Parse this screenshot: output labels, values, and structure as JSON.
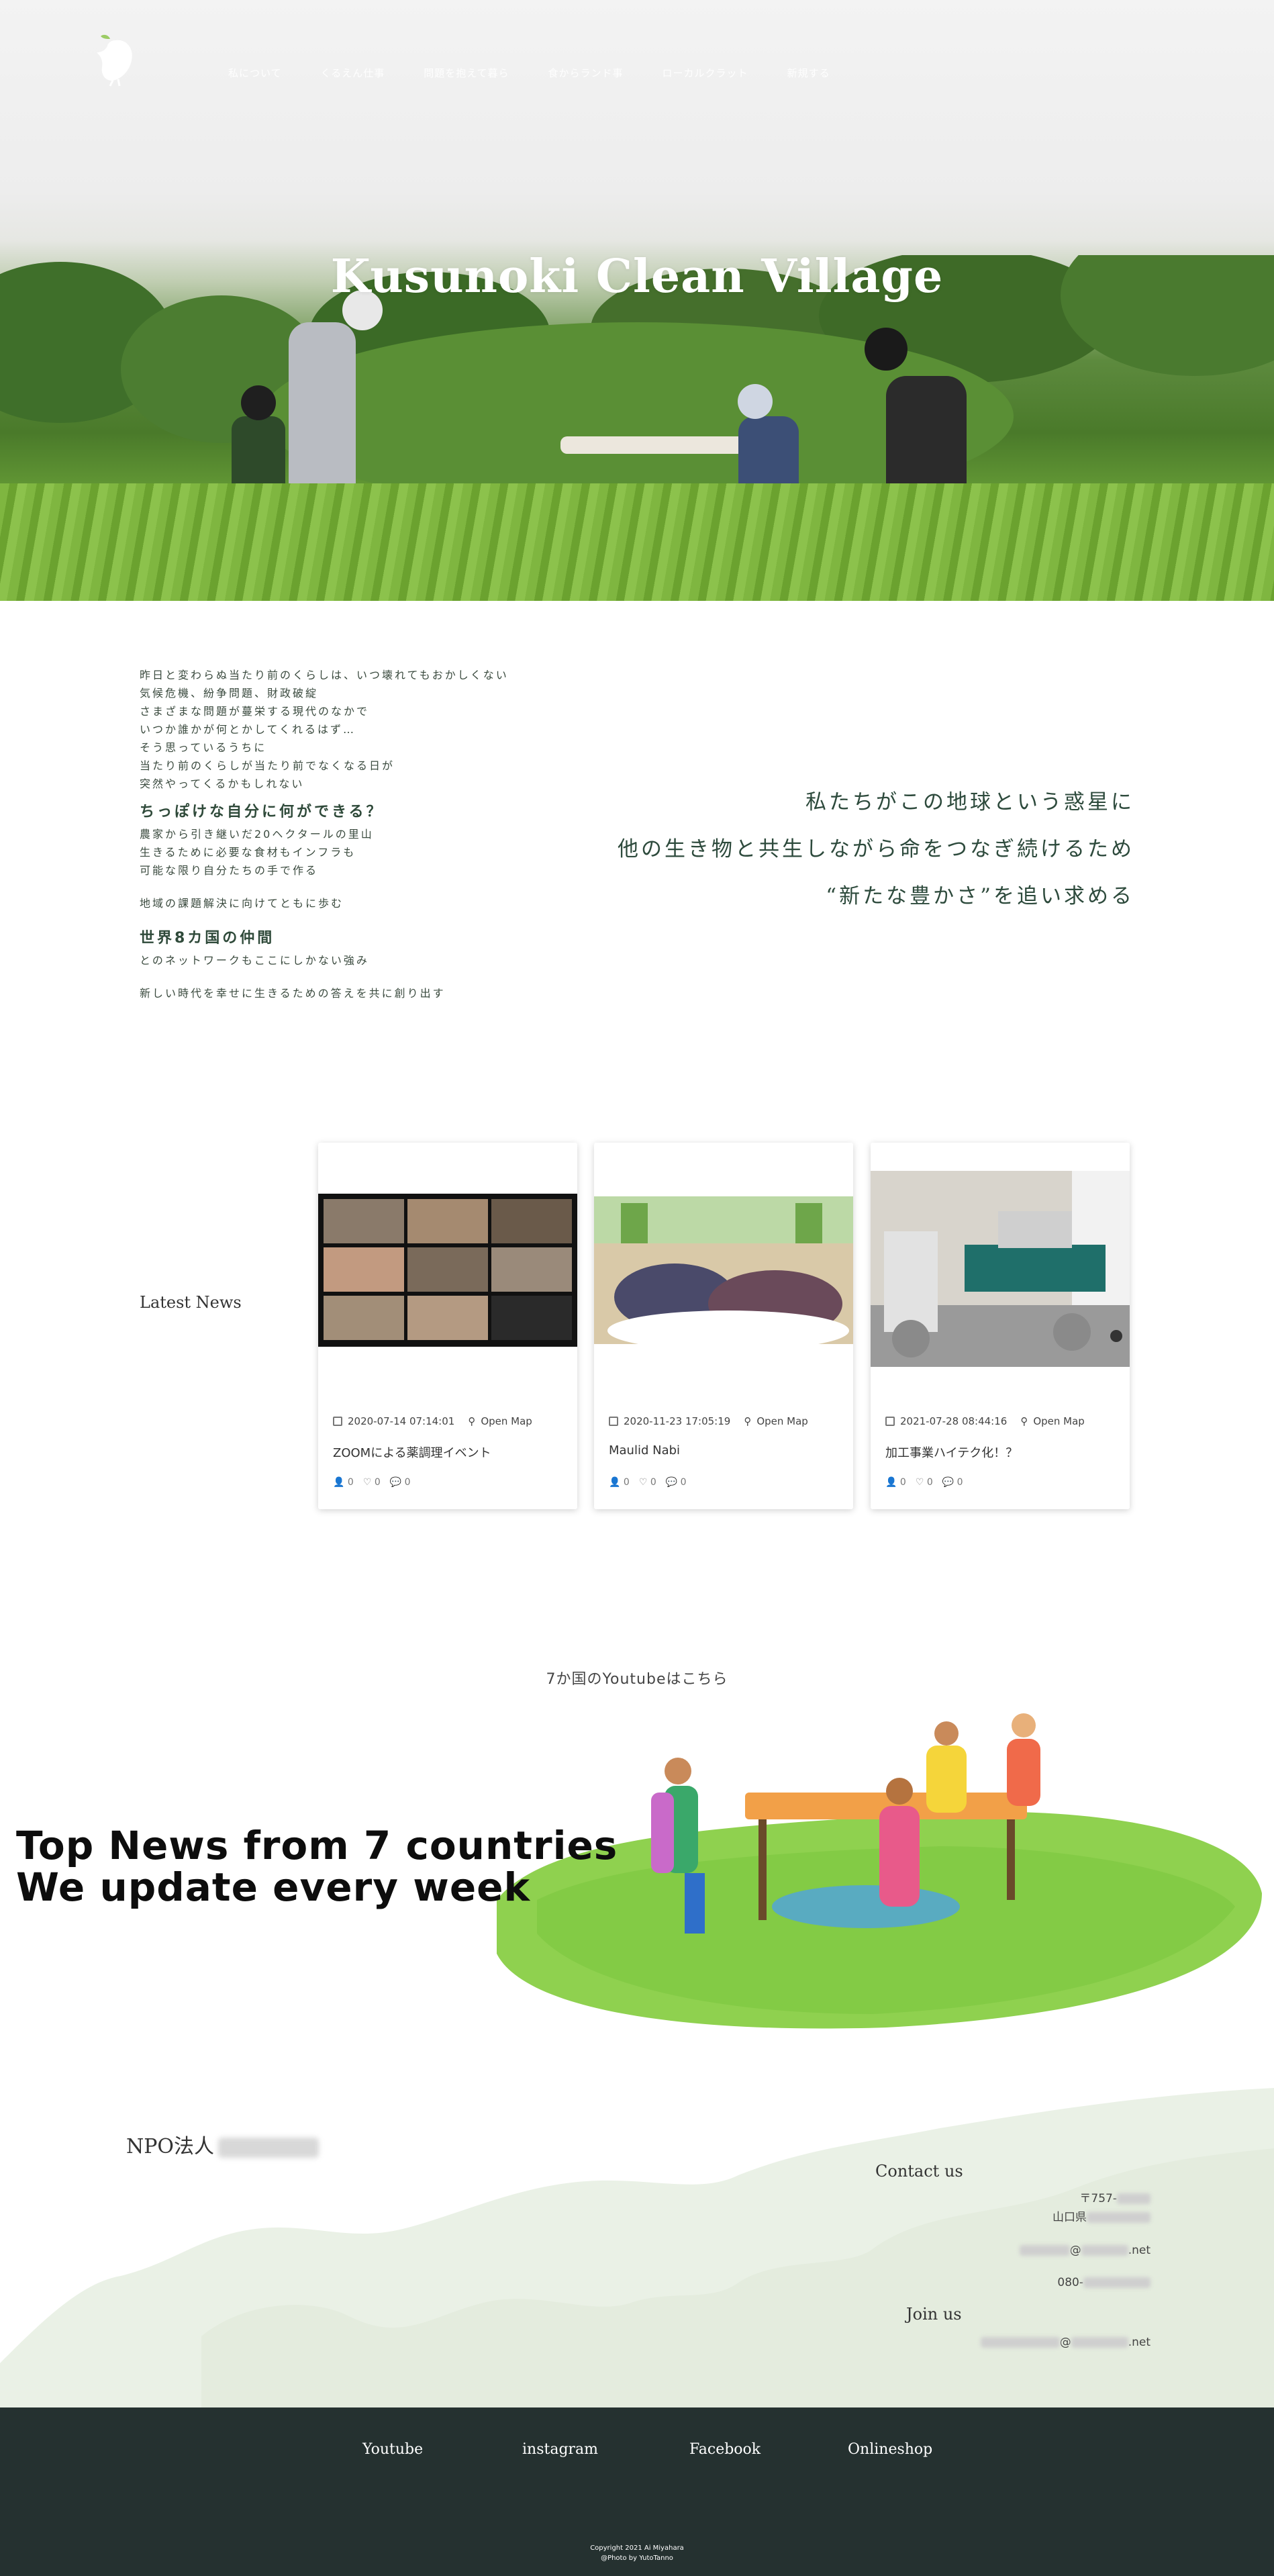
{
  "header": {
    "nav": [
      "私について",
      "くるえん仕事",
      "問題を抱えて暮ら",
      "食からランド事",
      "ローカルクラット",
      "新規する"
    ],
    "hero_title": "Kusunoki Clean Village"
  },
  "intro": {
    "lines_a": [
      "昨日と変わらぬ当たり前のくらしは、いつ壊れてもおかしくない",
      "気候危機、紛争問題、財政破綻",
      "さまざまな問題が蔓栄する現代のなかで",
      "いつか誰かが何とかしてくれるはず…",
      "そう思っているうちに",
      "当たり前のくらしが当たり前でなくなる日が",
      "突然やってくるかもしれない"
    ],
    "heading_1": "ちっぽけな自分に何ができる？",
    "lines_b": [
      "農家から引き継いだ20ヘクタールの里山",
      "生きるために必要な食材もインフラも",
      "可能な限り自分たちの手で作る"
    ],
    "line_c": "地域の課題解決に向けてともに歩む",
    "heading_2": "世界8カ国の仲間",
    "line_d": "とのネットワークもここにしかない強み",
    "line_e": "新しい時代を幸せに生きるための答えを共に創り出す",
    "right_lines": [
      "私たちがこの地球という惑星に",
      "他の生き物と共生しながら命をつなぎ続けるため",
      "“新たな豊かさ”を追い求める"
    ]
  },
  "news": {
    "label": "Latest News",
    "cards": [
      {
        "date": "2020-07-14 07:14:01",
        "map": "Open Map",
        "title": "ZOOMによる薬調理イベント",
        "likes": "0",
        "hearts": "0",
        "comments": "0"
      },
      {
        "date": "2020-11-23 17:05:19",
        "map": "Open Map",
        "title": "Maulid Nabi",
        "likes": "0",
        "hearts": "0",
        "comments": "0"
      },
      {
        "date": "2021-07-28 08:44:16",
        "map": "Open Map",
        "title": "加工事業ハイテク化！？",
        "likes": "0",
        "hearts": "0",
        "comments": "0"
      }
    ]
  },
  "youtube": {
    "label": "7か国のYoutubeはこちら",
    "headline_1": "Top News from 7 countries",
    "headline_2": "We update every week"
  },
  "contact": {
    "org": "NPO法人",
    "contact_title": "Contact us",
    "postal": "〒757-",
    "prefecture": "山口県",
    "email_suffix": "@",
    "email_domain": ".net",
    "phone_prefix": "080-",
    "join_title": "Join us",
    "join_at": "@",
    "join_domain": ".net"
  },
  "footer": {
    "links": [
      "Youtube",
      "instagram",
      "Facebook",
      "Onlineshop"
    ],
    "copyright": "Copyright 2021 Ai Miyahara",
    "photo": "@Photo by YutoTanno"
  }
}
